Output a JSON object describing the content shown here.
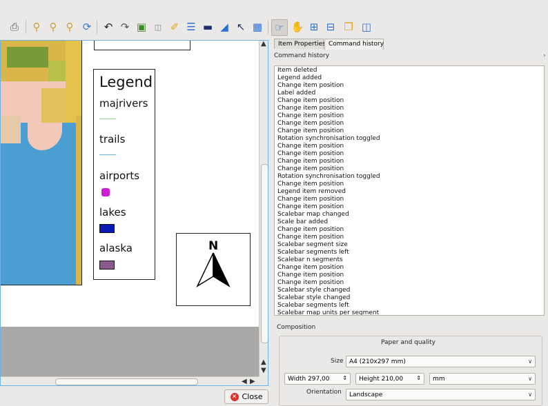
{
  "toolbar": {
    "icons": [
      "print-icon",
      "zoom-full-icon",
      "zoom-in-icon",
      "zoom-out-icon",
      "refresh-icon",
      "undo-icon",
      "redo-icon",
      "add-map-icon",
      "add-image-icon",
      "add-label-icon",
      "add-legend-icon",
      "add-scalebar-icon",
      "add-shape-icon",
      "add-arrow-icon",
      "add-table-icon",
      "select-move-item-icon",
      "move-item-content-icon",
      "group-icon",
      "ungroup-icon",
      "raise-items-icon",
      "align-icon"
    ]
  },
  "map": {
    "legend": {
      "title": "Legend",
      "items": [
        {
          "label": "majrivers",
          "symbol": "line",
          "color": "#8fd18a"
        },
        {
          "label": "trails",
          "symbol": "line",
          "color": "#5fb6e0"
        },
        {
          "label": "airports",
          "symbol": "marker",
          "color": "#d01ed7"
        },
        {
          "label": "lakes",
          "symbol": "box",
          "color": "#0a1bb5"
        },
        {
          "label": "alaska",
          "symbol": "box",
          "color": "#8a5a8a"
        }
      ]
    },
    "north_arrow": "N"
  },
  "close_button": {
    "label": "Close"
  },
  "tabs": [
    {
      "label": "Item Properties",
      "active": false
    },
    {
      "label": "Command history",
      "active": true
    }
  ],
  "command_history": {
    "header": "Command history",
    "items": [
      "Item deleted",
      "Legend added",
      "Change item position",
      "Label added",
      "Change item position",
      "Change item position",
      "Change item position",
      "Change item position",
      "Change item position",
      "Rotation synchronisation toggled",
      "Change item position",
      "Change item position",
      "Change item position",
      "Change item position",
      "Rotation synchronisation toggled",
      "Change item position",
      "Legend item removed",
      "Change item position",
      "Change item position",
      "Scalebar map changed",
      "Scale bar added",
      "Change item position",
      "Change item position",
      "Scalebar segment size",
      "Scalebar segments left",
      "Scalebar n segments",
      "Change item position",
      "Change item position",
      "Change item position",
      "Scalebar style changed",
      "Scalebar style changed",
      "Scalebar segments left",
      "Scalebar map units per segment"
    ]
  },
  "composition": {
    "header": "Composition",
    "paper_quality": "Paper and quality",
    "size_label": "Size",
    "size_value": "A4 (210x297 mm)",
    "width_value": "Width 297,00",
    "height_value": "Height 210,00",
    "unit_value": "mm",
    "orientation_label": "Orientation",
    "orientation_value": "Landscape"
  }
}
